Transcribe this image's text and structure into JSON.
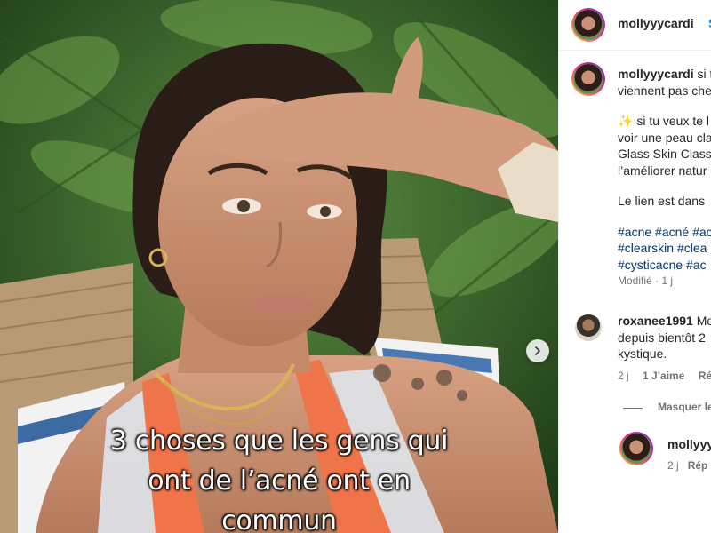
{
  "post": {
    "overlay_caption": [
      "3 choses que les gens qui",
      "ont de l’acné ont en",
      "commun"
    ]
  },
  "header": {
    "username": "mollyyycardi",
    "follow_label": "S"
  },
  "caption": {
    "username": "mollyyycardi",
    "line1_rest": "si t",
    "line2": "viennent pas che",
    "para2": [
      "✨ si tu veux te l",
      "voir une peau cla",
      "Glass Skin Class",
      "l’améliorer natur"
    ],
    "para3": "Le lien est dans",
    "hashtags": [
      "#acne #acné #ac",
      "#clearskin #clea",
      "#cysticacne #ac"
    ],
    "edited": "Modifié",
    "time": "1 j"
  },
  "comment": {
    "username": "roxanee1991",
    "line1_rest": "Mo",
    "line2": "depuis bientôt 2",
    "line3": "kystique.",
    "time": "2 j",
    "likes": "1 J’aime",
    "reply": "Rép"
  },
  "hide_replies": "Masquer le",
  "reply": {
    "username": "mollyyy",
    "time": "2 j",
    "reply_label": "Rép"
  },
  "colors": {
    "link": "#00376b",
    "follow": "#0095f6",
    "muted": "#737373"
  }
}
